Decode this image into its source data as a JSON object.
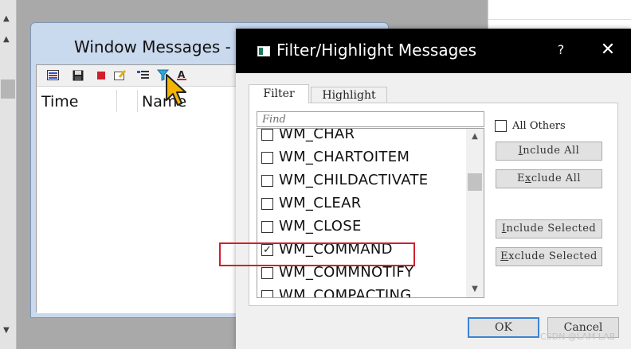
{
  "window_messages": {
    "title": "Window Messages - I",
    "columns": [
      "Time",
      "Name"
    ]
  },
  "dialog": {
    "title": "Filter/Highlight Messages",
    "help_label": "?",
    "close_label": "✕",
    "tabs": [
      "Filter",
      "Highlight"
    ],
    "find_placeholder": "Find",
    "messages": [
      {
        "label": "WM_CHAR",
        "checked": false
      },
      {
        "label": "WM_CHARTOITEM",
        "checked": false
      },
      {
        "label": "WM_CHILDACTIVATE",
        "checked": false
      },
      {
        "label": "WM_CLEAR",
        "checked": false
      },
      {
        "label": "WM_CLOSE",
        "checked": false
      },
      {
        "label": "WM_COMMAND",
        "checked": true
      },
      {
        "label": "WM_COMMNOTIFY",
        "checked": false
      },
      {
        "label": "WM_COMPACTING",
        "checked": false
      }
    ],
    "all_others_label": "All Others",
    "all_others_checked": false,
    "buttons": {
      "include_all": {
        "hotkey": "I",
        "rest": "nclude All"
      },
      "exclude_all": {
        "pre": "E",
        "hotkey": "x",
        "rest": "clude All"
      },
      "include_selected": {
        "hotkey": "I",
        "rest": "nclude Selected"
      },
      "exclude_selected": {
        "hotkey": "E",
        "rest": "xclude Selected"
      },
      "ok": "OK",
      "cancel": "Cancel"
    }
  },
  "watermark": "CSDN @LAM LAB",
  "colors": {
    "highlight_box": "#d21f2b",
    "titlebar": "#000000",
    "ok_focus": "#3b82d6"
  }
}
